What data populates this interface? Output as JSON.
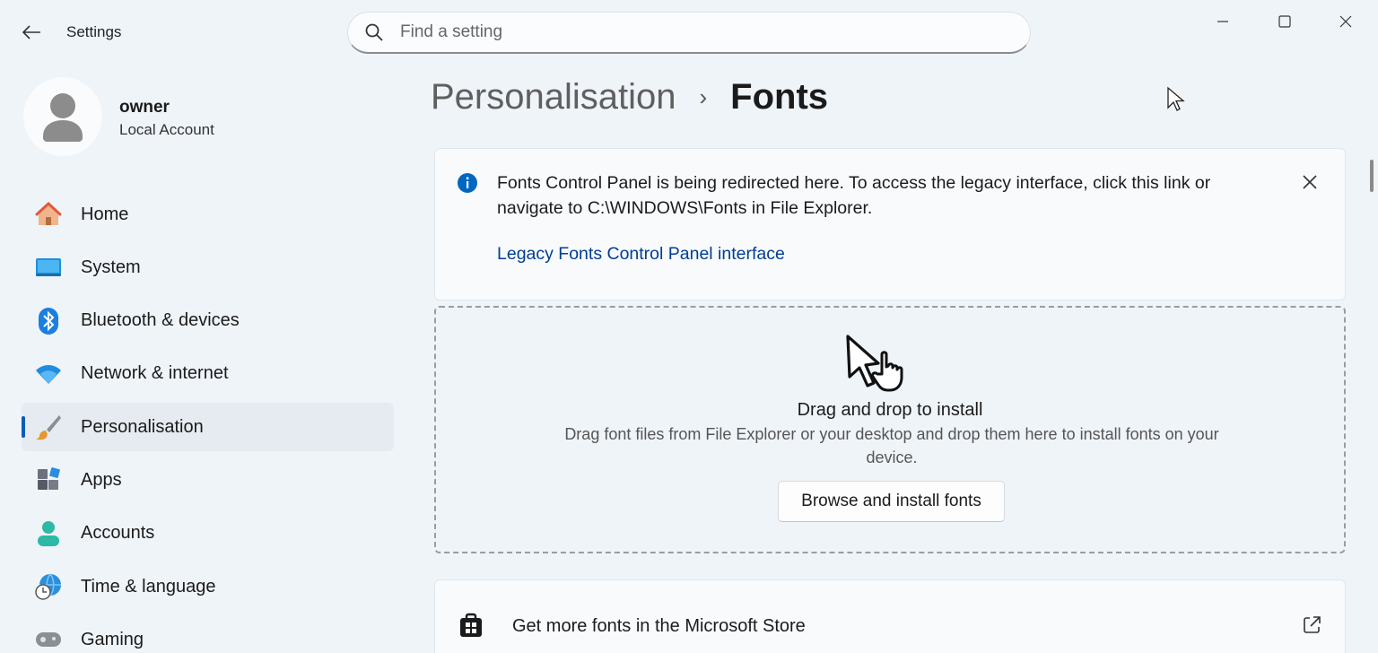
{
  "window": {
    "title": "Settings",
    "controls": [
      "minimize-icon",
      "maximize-icon",
      "close-icon"
    ]
  },
  "search": {
    "placeholder": "Find a setting",
    "value": ""
  },
  "profile": {
    "name": "owner",
    "account_type": "Local Account"
  },
  "sidebar": {
    "items": [
      {
        "label": "Home",
        "icon": "home-icon"
      },
      {
        "label": "System",
        "icon": "system-icon"
      },
      {
        "label": "Bluetooth & devices",
        "icon": "bluetooth-icon"
      },
      {
        "label": "Network & internet",
        "icon": "wifi-icon"
      },
      {
        "label": "Personalisation",
        "icon": "paintbrush-icon",
        "active": true
      },
      {
        "label": "Apps",
        "icon": "apps-icon"
      },
      {
        "label": "Accounts",
        "icon": "accounts-icon"
      },
      {
        "label": "Time & language",
        "icon": "globe-clock-icon"
      },
      {
        "label": "Gaming",
        "icon": "gamepad-icon"
      }
    ]
  },
  "breadcrumb": {
    "parent": "Personalisation",
    "separator": "›",
    "current": "Fonts"
  },
  "info_banner": {
    "message": "Fonts Control Panel is being redirected here. To access the legacy interface, click this link or navigate to C:\\WINDOWS\\Fonts in File Explorer.",
    "link_text": "Legacy Fonts Control Panel interface"
  },
  "drop_zone": {
    "title": "Drag and drop to install",
    "description": "Drag font files from File Explorer or your desktop and drop them here to install fonts on your device.",
    "button_label": "Browse and install fonts"
  },
  "store_link": {
    "label": "Get more fonts in the Microsoft Store"
  },
  "colors": {
    "accent": "#005fb8",
    "link": "#003e92",
    "background": "#eff4f9",
    "info_icon": "#0067c0"
  }
}
